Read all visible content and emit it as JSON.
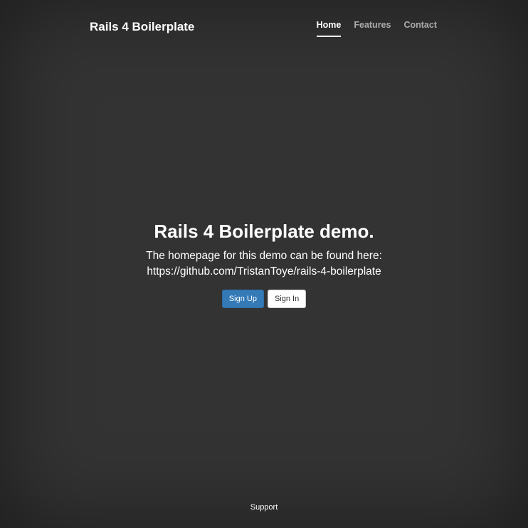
{
  "header": {
    "brand": "Rails 4 Boilerplate",
    "nav": [
      {
        "label": "Home",
        "active": true
      },
      {
        "label": "Features",
        "active": false
      },
      {
        "label": "Contact",
        "active": false
      }
    ]
  },
  "cover": {
    "heading": "Rails 4 Boilerplate demo.",
    "lead_line1": "The homepage for this demo can be found here:",
    "lead_line2": "https://github.com/TristanToye/rails-4-boilerplate",
    "signup_label": "Sign Up",
    "signin_label": "Sign In"
  },
  "footer": {
    "support_label": "Support"
  },
  "colors": {
    "background": "#333333",
    "primary_button": "#337ab7",
    "default_button": "#ffffff"
  }
}
